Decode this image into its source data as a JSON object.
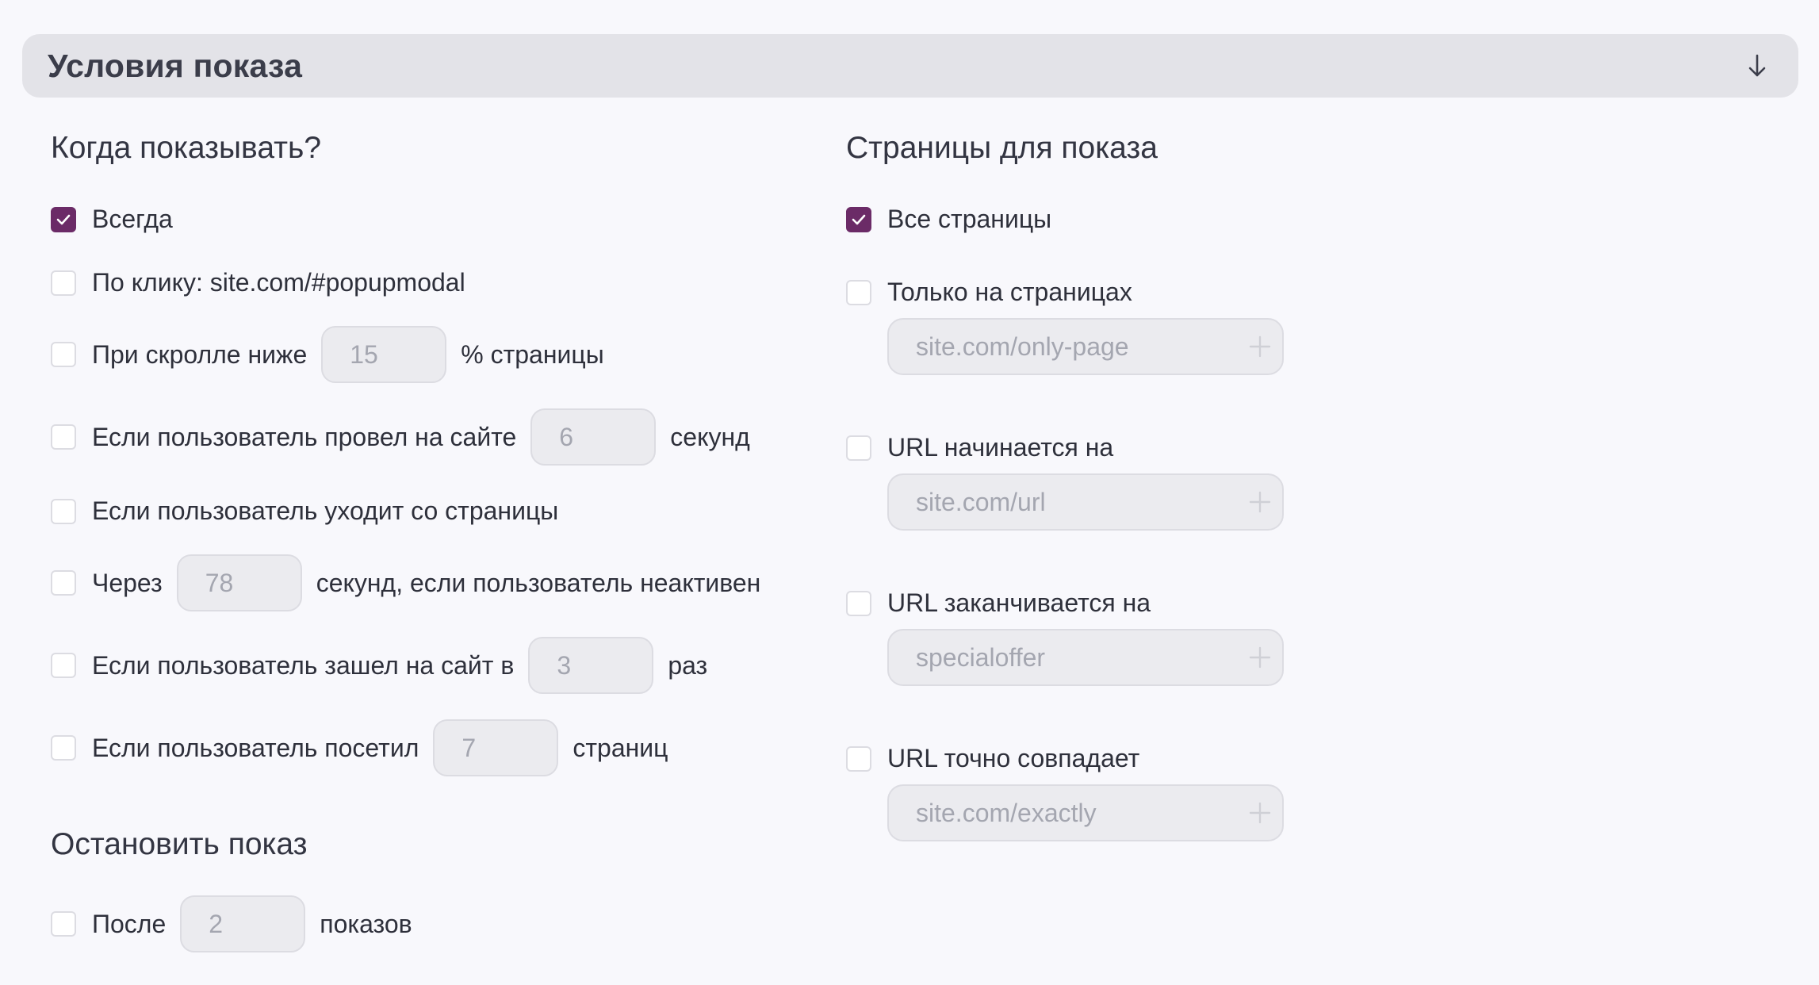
{
  "header": {
    "title": "Условия показа",
    "toggle_icon": "arrow-down-icon"
  },
  "when": {
    "title": "Когда показывать?",
    "always": {
      "label": "Всегда",
      "checked": true
    },
    "on_click": {
      "label": "По клику: site.com/#popupmodal",
      "checked": false
    },
    "on_scroll": {
      "label_before": "При скролле ниже",
      "value": "15",
      "label_after": "% страницы",
      "checked": false
    },
    "time_on_site": {
      "label_before": "Если пользователь провел на сайте",
      "value": "6",
      "label_after": "секунд",
      "checked": false
    },
    "exit_intent": {
      "label": "Если пользователь уходит со страницы",
      "checked": false
    },
    "inactive": {
      "label_before": "Через",
      "value": "78",
      "label_after": "секунд, если пользователь неактивен",
      "checked": false
    },
    "visits": {
      "label_before": "Если пользователь зашел на сайт в",
      "value": "3",
      "label_after": "раз",
      "checked": false
    },
    "pages_visited": {
      "label_before": "Если пользователь посетил",
      "value": "7",
      "label_after": "страниц",
      "checked": false
    }
  },
  "stop": {
    "title": "Остановить показ",
    "after": {
      "label_before": "После",
      "value": "2",
      "label_after": "показов",
      "checked": false
    }
  },
  "pages": {
    "title": "Страницы для показа",
    "all": {
      "label": "Все страницы",
      "checked": true
    },
    "only": {
      "label": "Только на страницах",
      "placeholder": "site.com/only-page",
      "checked": false
    },
    "starts_with": {
      "label": "URL начинается на",
      "placeholder": "site.com/url",
      "checked": false
    },
    "ends_with": {
      "label": "URL заканчивается на",
      "placeholder": "specialoffer",
      "checked": false
    },
    "exact": {
      "label": "URL точно совпадает",
      "placeholder": "site.com/exactly",
      "checked": false
    }
  },
  "colors": {
    "accent": "#6b2b67",
    "background": "#f8f8fc",
    "header_bg": "#e3e3e8",
    "input_bg": "#ebebef"
  }
}
